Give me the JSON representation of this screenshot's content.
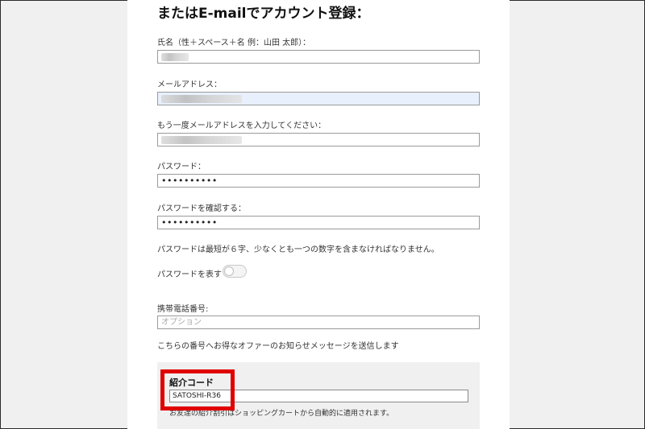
{
  "heading": "またはE-mailでアカウント登録：",
  "name_field": {
    "label": "氏名（性＋スペース＋名 例：山田 太郎）："
  },
  "email_field": {
    "label": "メールアドレス："
  },
  "email_confirm_field": {
    "label": "もう一度メールアドレスを入力してください："
  },
  "password_field": {
    "label": "パスワード：",
    "value": "••••••••••"
  },
  "password_confirm_field": {
    "label": "パスワードを確認する：",
    "value": "••••••••••"
  },
  "password_hint": "パスワードは最短が６字、少なくとも一つの数字を含まなければなりません。",
  "show_password": {
    "label": "パスワードを表す",
    "enabled": false
  },
  "phone_field": {
    "label": "携帯電話番号:",
    "placeholder": "オプション"
  },
  "phone_note": "こちらの番号へお得なオファーのお知らせメッセージを送信します",
  "referral": {
    "title": "紹介コード",
    "value": "SATOSHI-R36",
    "note": "お友達の紹介割引はショッピングカートから自動的に適用されます。",
    "highlight_color": "#e00000"
  },
  "colors": {
    "autofill_bg": "#e8f0fe",
    "referral_bg": "#f0f0f0"
  }
}
